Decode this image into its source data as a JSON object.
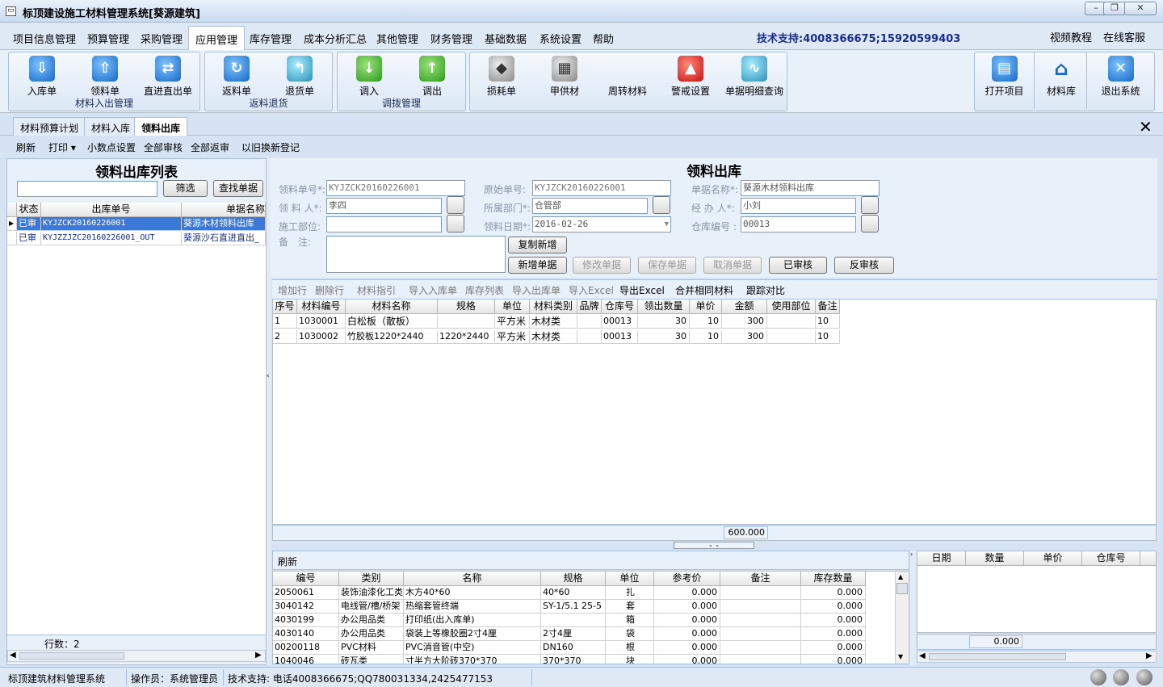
{
  "window": {
    "title": "标顶建设施工材料管理系统[葵源建筑]"
  },
  "menu": {
    "items": [
      "项目信息管理",
      "预算管理",
      "采购管理",
      "应用管理",
      "库存管理",
      "成本分析汇总",
      "其他管理",
      "财务管理",
      "基础数据",
      "系统设置",
      "帮助"
    ],
    "support": "技术支持:4008366675;15920599403",
    "video": "视频教程",
    "online": "在线客服"
  },
  "ribbon": {
    "g1": {
      "label": "材料入出管理",
      "btns": [
        "入库单",
        "领料单",
        "直进直出单"
      ]
    },
    "g2": {
      "label": "返料退货",
      "btns": [
        "返料单",
        "退货单"
      ]
    },
    "g3": {
      "label": "调拨管理",
      "btns": [
        "调入",
        "调出"
      ]
    },
    "g4": {
      "btns": [
        "损耗单",
        "甲供材",
        "周转材料",
        "警戒设置",
        "单据明细查询"
      ]
    },
    "g5": {
      "btns": [
        "打开项目",
        "材料库",
        "退出系统"
      ]
    }
  },
  "tabs": [
    "材料预算计划",
    "材料入库",
    "领料出库"
  ],
  "toolbar": {
    "refresh": "刷新",
    "print": "打印",
    "decimal": "小数点设置",
    "all_audit": "全部审核",
    "all_unaudit": "全部返审",
    "exchange": "以旧换新登记"
  },
  "left": {
    "title": "领料出库列表",
    "filter_btn": "筛选",
    "find_btn": "查找单据",
    "headers": [
      "状态",
      "出库单号",
      "单据名称"
    ],
    "rows": [
      [
        "已审",
        "KYJZCK20160226001",
        "葵源木材领料出库"
      ],
      [
        "已审",
        "KYJZZJZC20160226001_OUT",
        "葵源沙石直进直出_"
      ]
    ],
    "rowcount_label": "行数：2"
  },
  "form": {
    "title": "领料出库",
    "no_label": "领料单号*:",
    "no": "KYJZCK20160226001",
    "orig_label": "原始单号:",
    "orig": "KYJZCK20160226001",
    "name_label": "单据名称*:",
    "name": "葵源木材领料出库",
    "person_label": "领 料 人*:",
    "person": "李四",
    "dept_label": "所属部门*:",
    "dept": "仓管部",
    "handler_label": "经 办 人*:",
    "handler": "小刘",
    "site_label": "施工部位:",
    "site": "",
    "date_label": "领料日期*:",
    "date": "2016-02-26",
    "wh_label": "仓库编号 :",
    "wh": "00013",
    "remark_label": "备　注:",
    "copy_btn": "复制新增",
    "new_btn": "新增单据",
    "edit_btn": "修改单据",
    "save_btn": "保存单据",
    "cancel_btn": "取消单据",
    "audited_btn": "已审核",
    "unaudit_btn": "反审核"
  },
  "detail_toolbar": {
    "add": "增加行",
    "del": "删除行",
    "guide": "材料指引",
    "import_in": "导入入库单",
    "stock": "库存列表",
    "import_out": "导入出库单",
    "import_xls": "导入Excel",
    "export_xls": "导出Excel",
    "merge": "合并相同材料",
    "trace": "跟踪对比"
  },
  "detail": {
    "headers": [
      "序号",
      "材料编号",
      "材料名称",
      "规格",
      "单位",
      "材料类别",
      "品牌",
      "仓库号",
      "领出数量",
      "单价",
      "金额",
      "使用部位",
      "备注"
    ],
    "rows": [
      [
        "1",
        "1030001",
        "白松板（散板）",
        "",
        "平方米",
        "木材类",
        "",
        "00013",
        "30",
        "10",
        "300",
        "",
        "10"
      ],
      [
        "2",
        "1030002",
        "竹胶板1220*2440",
        "1220*2440",
        "平方米",
        "木材类",
        "",
        "00013",
        "30",
        "10",
        "300",
        "",
        "10"
      ]
    ],
    "total": "600.000"
  },
  "stock": {
    "refresh": "刷新",
    "headers": [
      "编号",
      "类别",
      "名称",
      "规格",
      "单位",
      "参考价",
      "备注",
      "库存数量"
    ],
    "rows": [
      [
        "2050061",
        "装饰油漆化工类",
        "木方40*60",
        "40*60",
        "扎",
        "0.000",
        "",
        "0.000"
      ],
      [
        "3040142",
        "电线管/槽/桥架",
        "热缩套管终端",
        "SY-1/5.1 25-5",
        "套",
        "0.000",
        "",
        "0.000"
      ],
      [
        "4030199",
        "办公用品类",
        "打印纸(出入库单)",
        "",
        "箱",
        "0.000",
        "",
        "0.000"
      ],
      [
        "4030140",
        "办公用品类",
        "袋装上等橡胶圈2寸4厘",
        "2寸4厘",
        "袋",
        "0.000",
        "",
        "0.000"
      ],
      [
        "00200118",
        "PVC材料",
        "PVC消音管(中空)",
        "DN160",
        "根",
        "0.000",
        "",
        "0.000"
      ],
      [
        "1040046",
        "砖瓦类",
        "寸半方大阶砖370*370",
        "370*370",
        "块",
        "0.000",
        "",
        "0.000"
      ]
    ]
  },
  "history": {
    "headers": [
      "日期",
      "数量",
      "单价",
      "仓库号"
    ],
    "total": "0.000"
  },
  "status": {
    "app": "标顶建筑材料管理系统",
    "operator": "操作员：系统管理员",
    "support": "技术支持: 电话4008366675;QQ780031334,2425477153"
  }
}
